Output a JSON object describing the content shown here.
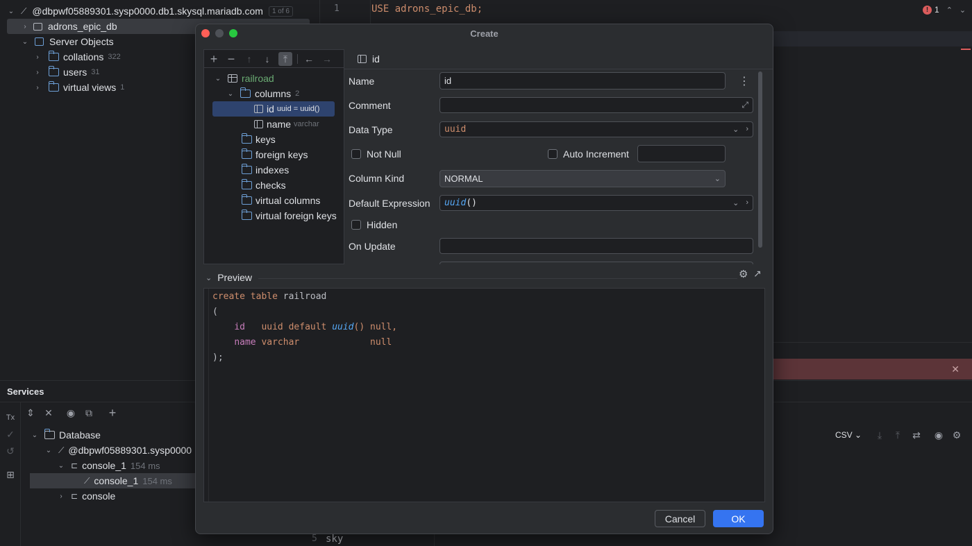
{
  "db_tree": {
    "connection": "@dbpwf05889301.sysp0000.db1.skysql.mariadb.com",
    "connection_badge": "1 of 6",
    "schema": "adrons_epic_db",
    "server_objects": "Server Objects",
    "items": [
      {
        "label": "collations",
        "count": "322"
      },
      {
        "label": "users",
        "count": "31"
      },
      {
        "label": "virtual views",
        "count": "1"
      }
    ]
  },
  "editor": {
    "line1_no": "1",
    "line1_code": "USE adrons_epic_db;",
    "line5_no": "5",
    "line5_code": "sky",
    "error_count": "1"
  },
  "services": {
    "title": "Services",
    "database": "Database",
    "connection": "@dbpwf05889301.sysp0000",
    "console_parent": "console_1",
    "console_parent_time": "154 ms",
    "console_child": "console_1",
    "console_child_time": "154 ms",
    "console": "console",
    "csv": "CSV"
  },
  "dialog": {
    "title": "Create",
    "tree": {
      "table": "railroad",
      "columns_label": "columns",
      "columns_count": "2",
      "col1_name": "id",
      "col1_detail": "uuid = uuid()",
      "col2_name": "name",
      "col2_detail": "varchar",
      "folders": [
        "keys",
        "foreign keys",
        "indexes",
        "checks",
        "virtual columns",
        "virtual foreign keys"
      ]
    },
    "header": "id",
    "form": {
      "name_label": "Name",
      "name_value": "id",
      "comment_label": "Comment",
      "comment_value": "",
      "datatype_label": "Data Type",
      "datatype_value": "uuid",
      "notnull_label": "Not Null",
      "autoinc_label": "Auto Increment",
      "kind_label": "Column Kind",
      "kind_value": "NORMAL",
      "default_label": "Default Expression",
      "default_fn": "uuid",
      "default_parens": "()",
      "hidden_label": "Hidden",
      "onupdate_label": "On Update",
      "onupdate_value": ""
    },
    "preview": {
      "title": "Preview",
      "line1_kw": "create table",
      "line1_name": "railroad",
      "line2": "(",
      "line3_col": "id",
      "line3_type": "uuid default",
      "line3_fn": "uuid",
      "line3_rest": "() null,",
      "line4_col": "name",
      "line4_type": "varchar",
      "line4_rest": "null",
      "line5": ");"
    },
    "cancel": "Cancel",
    "ok": "OK"
  },
  "colors": {
    "accent": "#3574f0",
    "selection": "#2e436e",
    "error_bar": "#5c3438",
    "green_light": "#28c840"
  }
}
